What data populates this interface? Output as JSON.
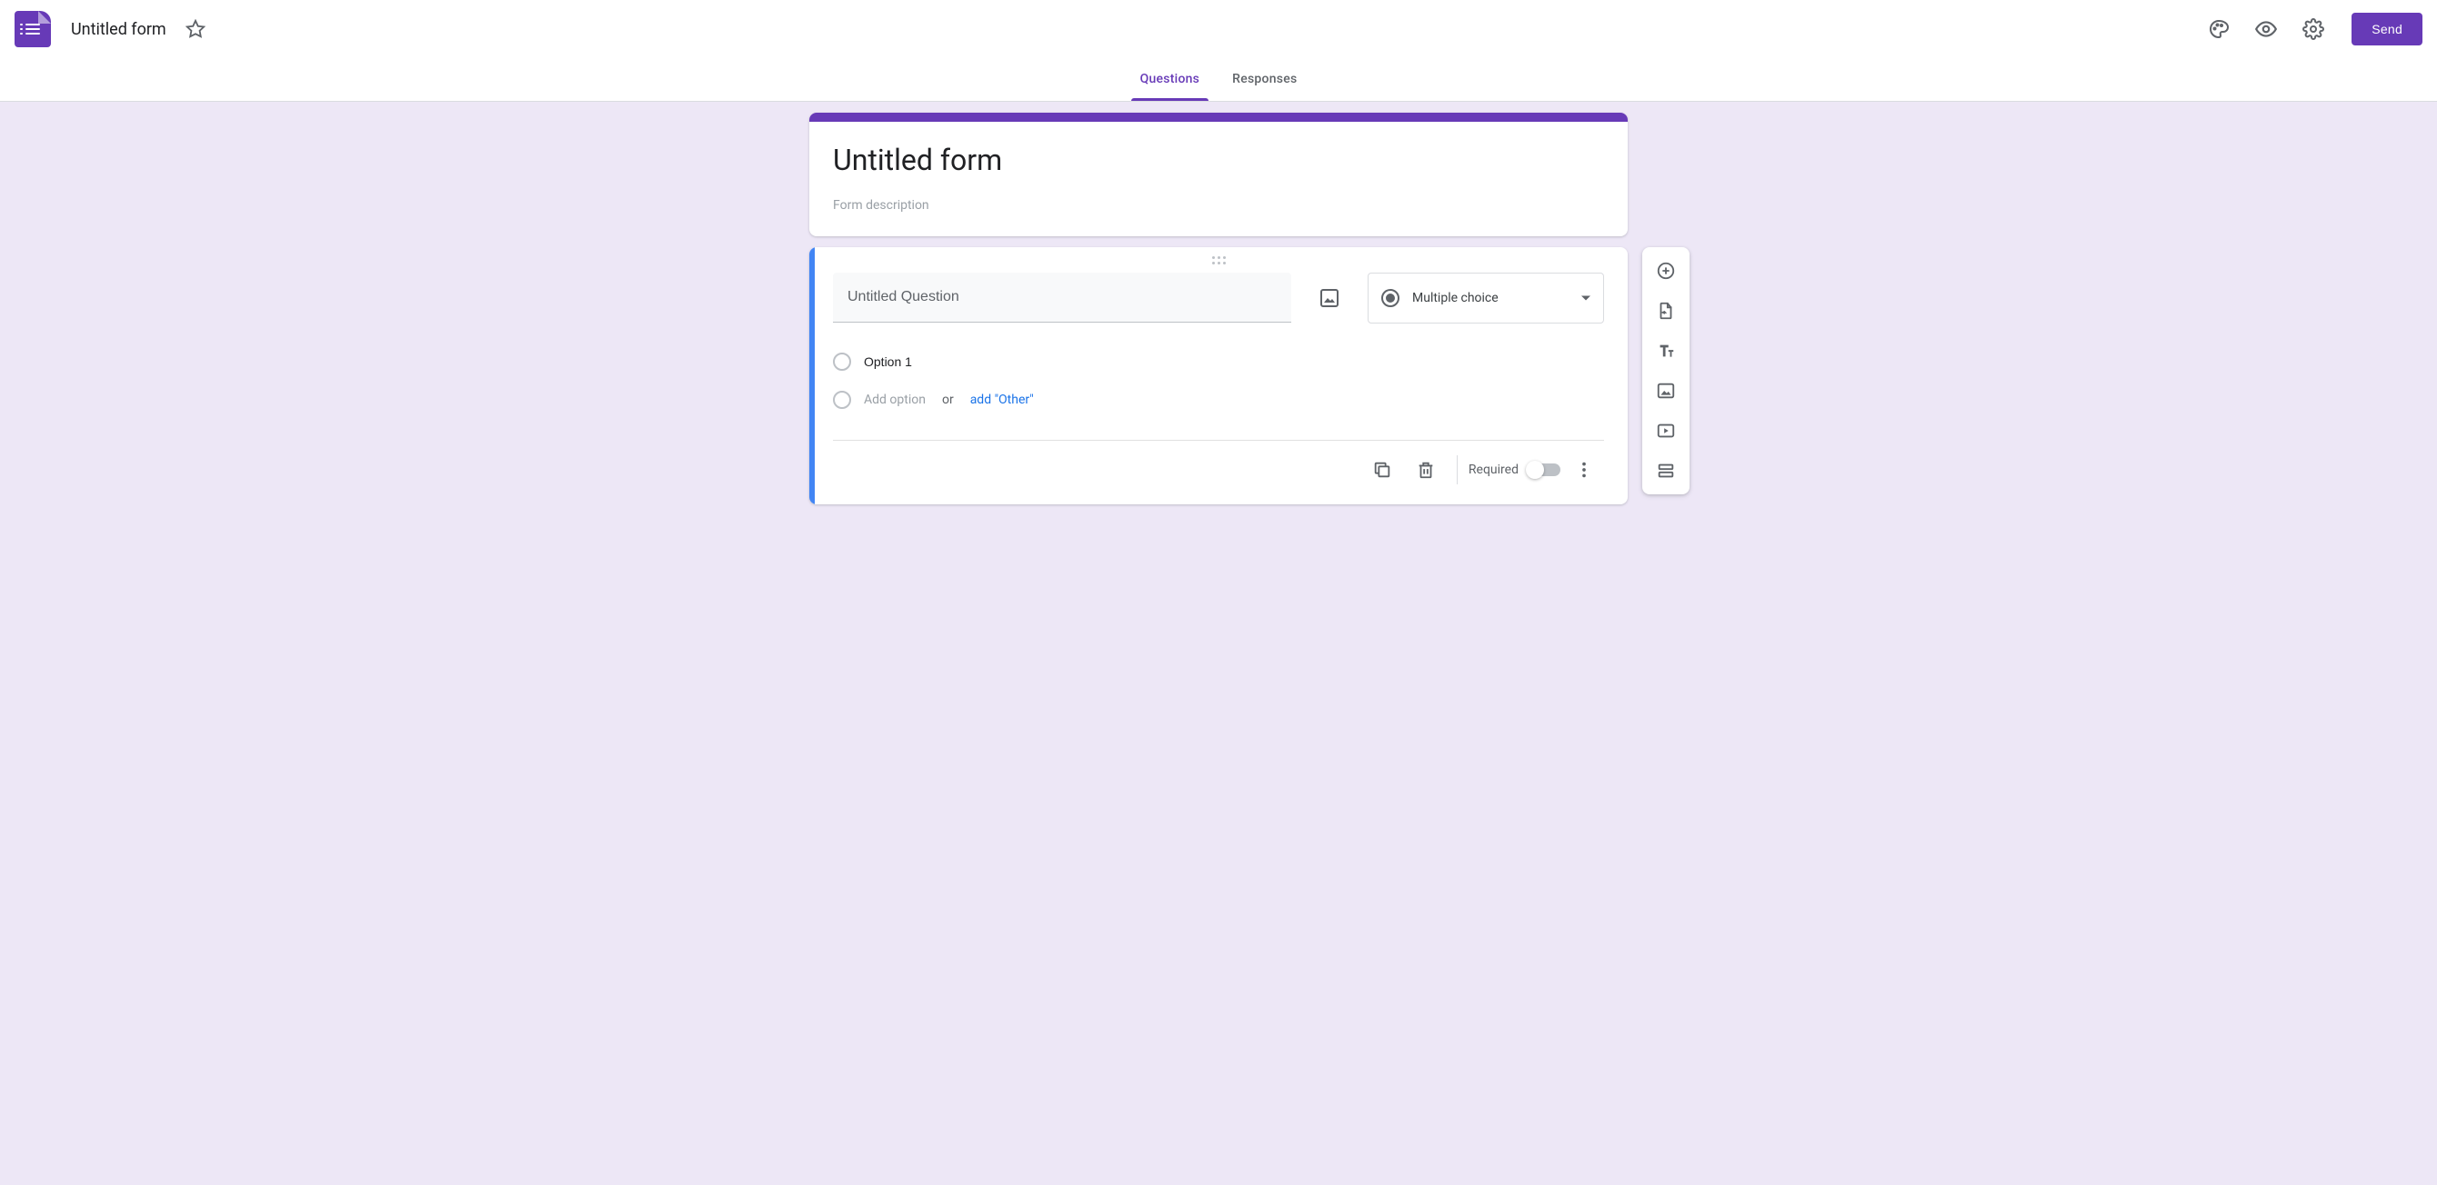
{
  "header": {
    "doc_title": "Untitled form",
    "send_label": "Send"
  },
  "tabs": {
    "questions": "Questions",
    "responses": "Responses",
    "active": "questions"
  },
  "form": {
    "title": "Untitled form",
    "description_placeholder": "Form description"
  },
  "question": {
    "title_value": "",
    "title_placeholder": "Untitled Question",
    "type_label": "Multiple choice",
    "options": [
      {
        "label": "Option 1"
      }
    ],
    "add_option_placeholder": "Add option",
    "or_text": "or",
    "add_other_text": "add \"Other\"",
    "required_label": "Required",
    "required": false
  },
  "toolbar_icons": {
    "add_question": "add-circle-icon",
    "import_questions": "import-icon",
    "add_title": "text-title-icon",
    "add_image": "image-icon",
    "add_video": "video-icon",
    "add_section": "section-icon"
  },
  "colors": {
    "primary": "#673ab7",
    "active_blue": "#4285f4",
    "link": "#1a73e8",
    "canvas_bg": "#ede7f6"
  }
}
